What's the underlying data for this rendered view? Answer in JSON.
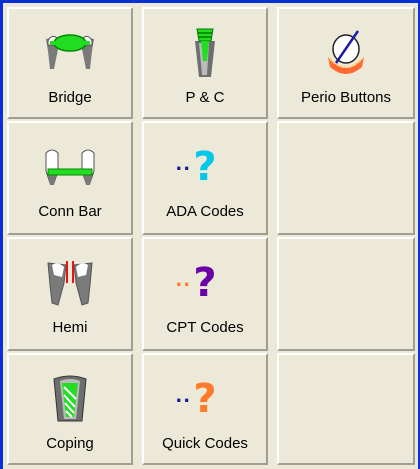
{
  "buttons": [
    {
      "label": "Bridge",
      "icon": "bridge-icon"
    },
    {
      "label": "P & C",
      "icon": "post-and-core-icon"
    },
    {
      "label": "Perio Buttons",
      "icon": "perio-icon"
    },
    {
      "label": "Conn Bar",
      "icon": "connector-bar-icon"
    },
    {
      "label": "ADA Codes",
      "icon": "ada-codes-icon",
      "color": "#00c0e0"
    },
    {
      "label": "Hemi",
      "icon": "hemisection-icon"
    },
    {
      "label": "CPT Codes",
      "icon": "cpt-codes-icon",
      "color": "#6a00a8"
    },
    {
      "label": "Coping",
      "icon": "coping-icon"
    },
    {
      "label": "Quick Codes",
      "icon": "quick-codes-icon",
      "color": "#ff7a2a"
    }
  ],
  "colors": {
    "frame": "#0b2fd6",
    "button_face": "#ece9d8",
    "accent_green": "#22dd22"
  }
}
